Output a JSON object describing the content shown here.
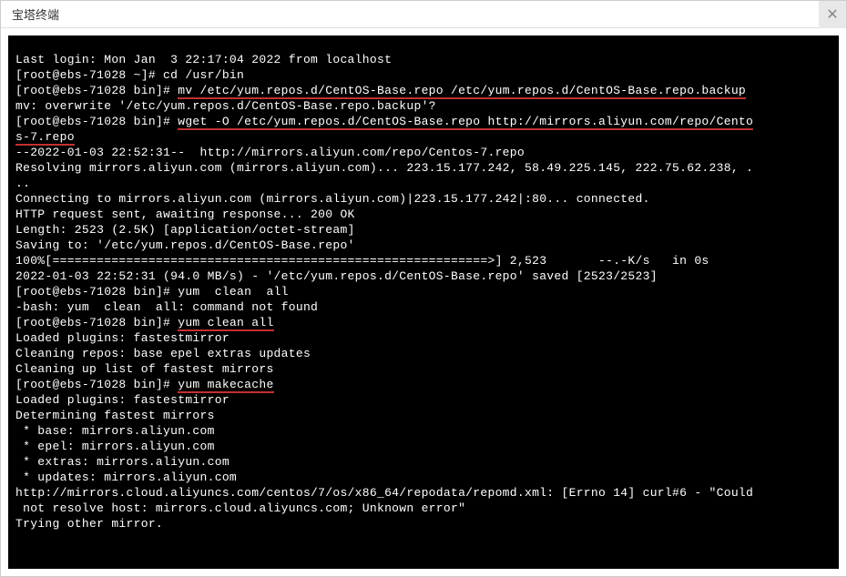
{
  "titlebar": {
    "title": "宝塔终端",
    "close_label": "✕"
  },
  "terminal": {
    "lines": [
      {
        "t": "Last login: Mon Jan  3 22:17:04 2022 from localhost"
      },
      {
        "t": "[root@ebs-71028 ~]# cd /usr/bin"
      },
      {
        "prefix": "[root@ebs-71028 bin]# ",
        "cmd": "mv /etc/yum.repos.d/CentOS-Base.repo /etc/yum.repos.d/CentOS-Base.repo.backup",
        "underline": true
      },
      {
        "t": "mv: overwrite '/etc/yum.repos.d/CentOS-Base.repo.backup'? "
      },
      {
        "prefix": "[root@ebs-71028 bin]# ",
        "cmd": "wget -O /etc/yum.repos.d/CentOS-Base.repo http://mirrors.aliyun.com/repo/Cento",
        "underline": true,
        "cont_cmd": "s-7.repo",
        "cont_underline": true
      },
      {
        "t": "--2022-01-03 22:52:31--  http://mirrors.aliyun.com/repo/Centos-7.repo"
      },
      {
        "t": "Resolving mirrors.aliyun.com (mirrors.aliyun.com)... 223.15.177.242, 58.49.225.145, 222.75.62.238, ."
      },
      {
        "t": ".."
      },
      {
        "t": "Connecting to mirrors.aliyun.com (mirrors.aliyun.com)|223.15.177.242|:80... connected."
      },
      {
        "t": "HTTP request sent, awaiting response... 200 OK"
      },
      {
        "t": "Length: 2523 (2.5K) [application/octet-stream]"
      },
      {
        "t": "Saving to: '/etc/yum.repos.d/CentOS-Base.repo'"
      },
      {
        "t": ""
      },
      {
        "t": "100%[===========================================================>] 2,523       --.-K/s   in 0s"
      },
      {
        "t": ""
      },
      {
        "t": "2022-01-03 22:52:31 (94.0 MB/s) - '/etc/yum.repos.d/CentOS-Base.repo' saved [2523/2523]"
      },
      {
        "t": ""
      },
      {
        "t": "[root@ebs-71028 bin]# yum  clean  all"
      },
      {
        "t": "-bash: yum  clean  all: command not found"
      },
      {
        "prefix": "[root@ebs-71028 bin]# ",
        "cmd": "yum clean all",
        "underline": true
      },
      {
        "t": "Loaded plugins: fastestmirror"
      },
      {
        "t": "Cleaning repos: base epel extras updates"
      },
      {
        "t": "Cleaning up list of fastest mirrors"
      },
      {
        "prefix": "[root@ebs-71028 bin]# ",
        "cmd": "yum makecache",
        "underline": true
      },
      {
        "t": "Loaded plugins: fastestmirror"
      },
      {
        "t": "Determining fastest mirrors"
      },
      {
        "t": " * base: mirrors.aliyun.com"
      },
      {
        "t": " * epel: mirrors.aliyun.com"
      },
      {
        "t": " * extras: mirrors.aliyun.com"
      },
      {
        "t": " * updates: mirrors.aliyun.com"
      },
      {
        "t": "http://mirrors.cloud.aliyuncs.com/centos/7/os/x86_64/repodata/repomd.xml: [Errno 14] curl#6 - \"Could"
      },
      {
        "t": " not resolve host: mirrors.cloud.aliyuncs.com; Unknown error\""
      },
      {
        "t": "Trying other mirror."
      }
    ]
  }
}
